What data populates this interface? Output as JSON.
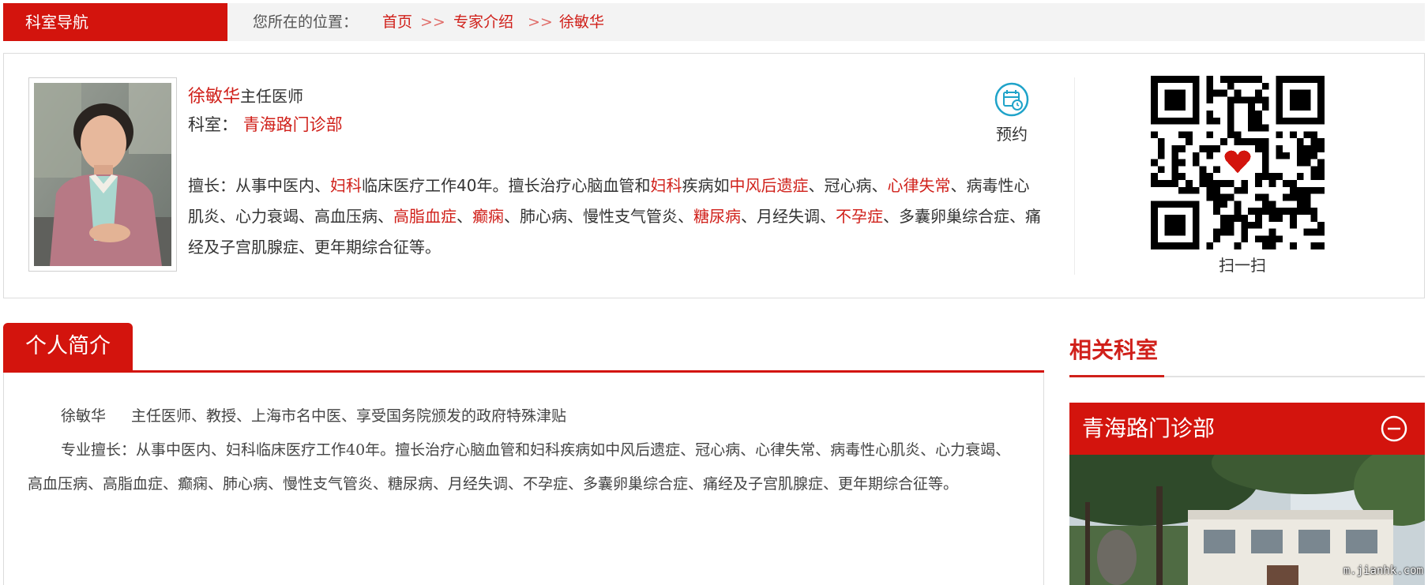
{
  "nav": {
    "title": "科室导航",
    "location_label": "您所在的位置：",
    "crumbs": [
      "首页",
      "专家介绍",
      "徐敏华"
    ],
    "separator": ">>"
  },
  "doctor": {
    "name": "徐敏华",
    "title": "主任医师",
    "dept_label": "科室：",
    "dept": "青海路门诊部",
    "booking_label": "预约",
    "speciality_prefix": "擅长：",
    "speciality_segments": [
      "从事中医内、",
      "妇科",
      "临床医疗工作40年。擅长治疗心脑血管和",
      "妇科",
      "疾病如",
      "中风后遗症",
      "、冠心病、",
      "心律失常",
      "、病毒性心肌炎、心力衰竭、高血压病、",
      "高脂血症",
      "、",
      "癫痫",
      "、肺心病、慢性支气管炎、",
      "糖尿病",
      "、月经失调、",
      "不孕症",
      "、多囊卵巢综合症、痛经及子宫肌腺症、更年期综合征等。"
    ],
    "scan_label": "扫一扫"
  },
  "profile": {
    "tab_label": "个人简介",
    "line1_name": "徐敏华",
    "line1_text": "主任医师、教授、上海市名中医、享受国务院颁发的政府特殊津贴",
    "line2_text": "专业擅长：从事中医内、妇科临床医疗工作40年。擅长治疗心脑血管和妇科疾病如中风后遗症、冠心病、心律失常、病毒性心肌炎、心力衰竭、高血压病、高脂血症、癫痫、肺心病、慢性支气管炎、糖尿病、月经失调、不孕症、多囊卵巢综合症、痛经及子宫肌腺症、更年期综合征等。"
  },
  "related": {
    "title": "相关科室",
    "dept_name": "青海路门诊部",
    "watermark": "m.jianhk.com"
  },
  "colors": {
    "brand_red": "#d3140d",
    "link_red": "#d0201a",
    "booking_teal": "#1fa3c9"
  },
  "icons": {
    "booking": "calendar-clock-icon",
    "collapse": "minus-circle-icon",
    "qr": "qr-code"
  }
}
